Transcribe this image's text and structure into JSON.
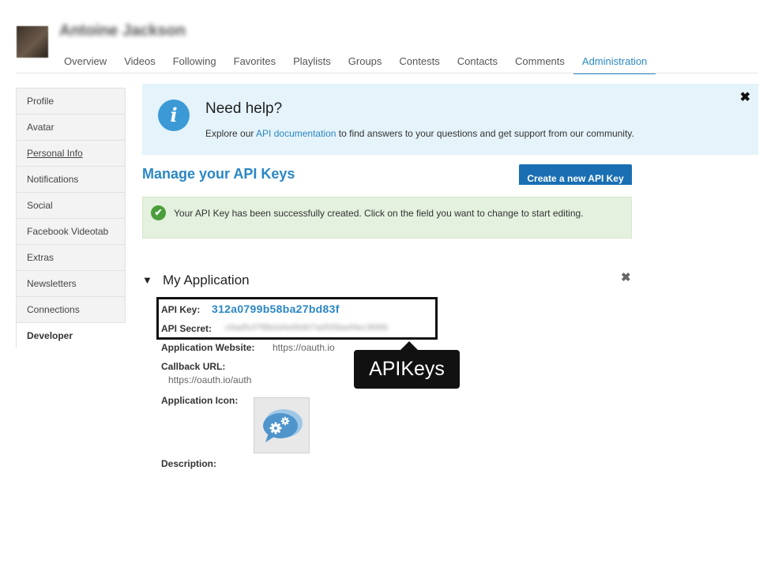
{
  "user": {
    "name": "Antoine Jackson"
  },
  "nav": {
    "items": [
      {
        "label": "Overview"
      },
      {
        "label": "Videos"
      },
      {
        "label": "Following"
      },
      {
        "label": "Favorites"
      },
      {
        "label": "Playlists"
      },
      {
        "label": "Groups"
      },
      {
        "label": "Contests"
      },
      {
        "label": "Contacts"
      },
      {
        "label": "Comments"
      },
      {
        "label": "Administration",
        "active": true
      }
    ]
  },
  "sidebar": {
    "items": [
      {
        "label": "Profile"
      },
      {
        "label": "Avatar"
      },
      {
        "label": "Personal Info"
      },
      {
        "label": "Notifications"
      },
      {
        "label": "Social"
      },
      {
        "label": "Facebook Videotab"
      },
      {
        "label": "Extras"
      },
      {
        "label": "Newsletters"
      },
      {
        "label": "Connections"
      },
      {
        "label": "Developer",
        "active": true
      }
    ]
  },
  "help": {
    "icon": "info-icon",
    "title": "Need help?",
    "text_before": "Explore our ",
    "link": "API documentation",
    "text_after": " to find answers to your questions and get support from our community.",
    "close": "✖"
  },
  "page": {
    "title": "Manage your API Keys",
    "create_button": "Create a new API Key"
  },
  "alert": {
    "icon": "check-icon",
    "text": "Your API Key has been successfully created. Click on the field you want to change to start editing."
  },
  "application": {
    "toggle": "▼",
    "name": "My Application",
    "close": "✖",
    "api_key_label": "API Key:",
    "api_key": "312a0799b58ba27bd83f",
    "api_secret_label": "API Secret:",
    "api_secret": "c9ad5cf7f8b0d4e6b907a0f35ba49ec3fd96",
    "website_label": "Application Website:",
    "website": "https://oauth.io",
    "callback_label": "Callback URL:",
    "callback": "https://oauth.io/auth",
    "icon_label": "Application Icon:",
    "description_label": "Description:"
  },
  "annotation": {
    "label": "APIKeys"
  },
  "colors": {
    "accent": "#2b87c5",
    "button": "#1a6fb3",
    "help_bg": "#e5f3fa",
    "success_bg": "#e4f1de",
    "success_icon": "#4a9e3b"
  }
}
